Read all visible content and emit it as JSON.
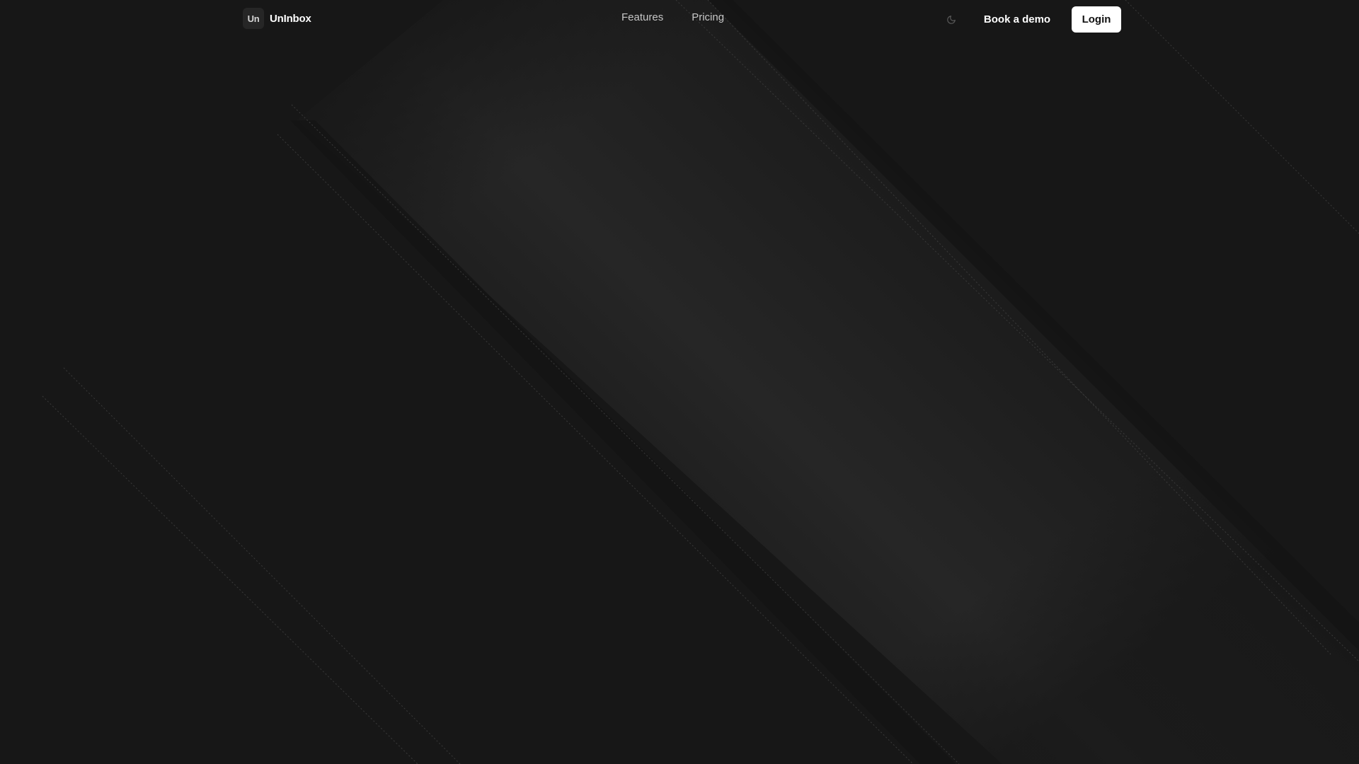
{
  "brand": {
    "mark": "Un",
    "name": "UnInbox"
  },
  "nav": {
    "items": [
      {
        "label": "Features"
      },
      {
        "label": "Pricing"
      }
    ]
  },
  "actions": {
    "theme_icon": "moon-icon",
    "demo_label": "Book a demo",
    "login_label": "Login"
  },
  "theme": {
    "background": "#171717",
    "text_primary": "#ffffff",
    "text_secondary": "#c7c7c7",
    "button_light_bg": "#ffffff",
    "button_light_text": "#111111"
  }
}
